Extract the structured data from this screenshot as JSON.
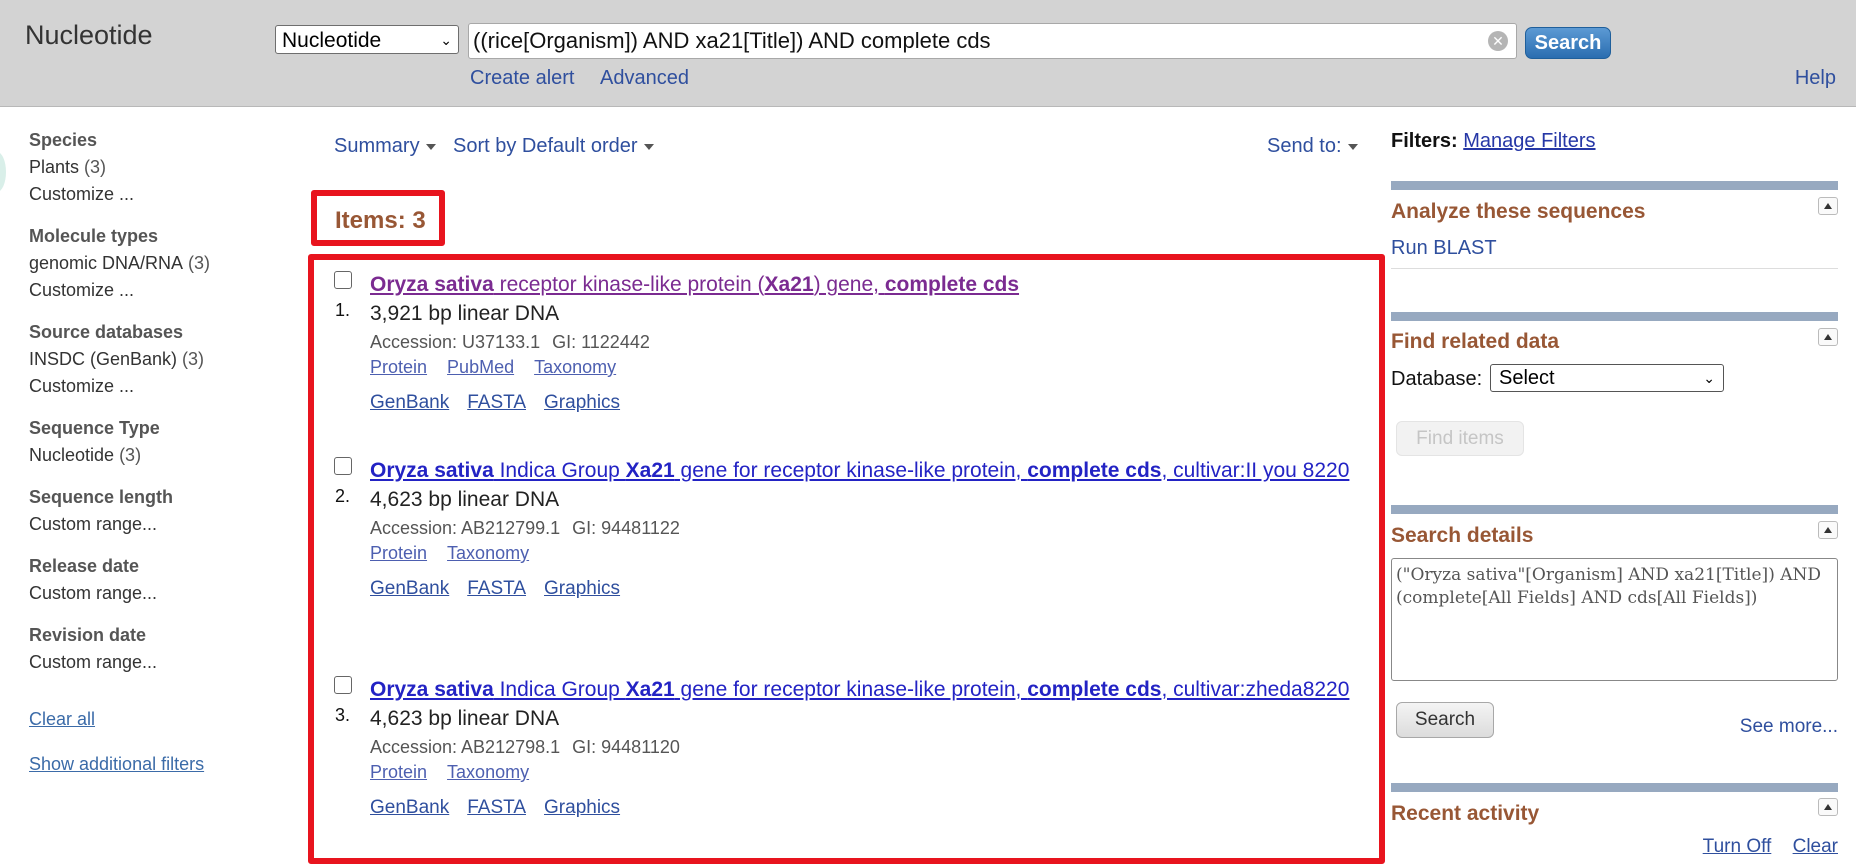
{
  "header": {
    "app_title": "Nucleotide",
    "db_select_value": "Nucleotide",
    "search_query": "((rice[Organism]) AND xa21[Title]) AND complete cds",
    "search_button": "Search",
    "create_alert": "Create alert",
    "advanced": "Advanced",
    "help": "Help"
  },
  "sidebar": {
    "facets": [
      {
        "heading": "Species",
        "items": [
          {
            "label": "Plants",
            "count": "(3)"
          },
          {
            "label": "Customize ...",
            "count": ""
          }
        ]
      },
      {
        "heading": "Molecule types",
        "items": [
          {
            "label": "genomic DNA/RNA",
            "count": "(3)"
          },
          {
            "label": "Customize ...",
            "count": ""
          }
        ]
      },
      {
        "heading": "Source databases",
        "items": [
          {
            "label": "INSDC (GenBank)",
            "count": "(3)"
          },
          {
            "label": "Customize ...",
            "count": ""
          }
        ]
      },
      {
        "heading": "Sequence Type",
        "items": [
          {
            "label": "Nucleotide",
            "count": "(3)"
          }
        ]
      },
      {
        "heading": "Sequence length",
        "items": [
          {
            "label": "Custom range...",
            "count": ""
          }
        ]
      },
      {
        "heading": "Release date",
        "items": [
          {
            "label": "Custom range...",
            "count": ""
          }
        ]
      },
      {
        "heading": "Revision date",
        "items": [
          {
            "label": "Custom range...",
            "count": ""
          }
        ]
      }
    ],
    "clear_all": "Clear all",
    "show_additional": "Show additional filters"
  },
  "toolbar": {
    "summary": "Summary",
    "sort": "Sort by Default order",
    "send_to": "Send to:"
  },
  "items_count": "Items: 3",
  "results": [
    {
      "number": "1.",
      "title_parts": [
        {
          "t": "Oryza sativa",
          "b": true
        },
        {
          "t": " receptor kinase-like protein (",
          "b": false
        },
        {
          "t": "Xa21",
          "b": true
        },
        {
          "t": ") gene, ",
          "b": false
        },
        {
          "t": "complete cds",
          "b": true
        }
      ],
      "visited": true,
      "meta": "3,921 bp linear DNA",
      "accession": "Accession: U37133.1",
      "gi": "GI: 1122442",
      "links": [
        "Protein",
        "PubMed",
        "Taxonomy"
      ],
      "links2": [
        "GenBank",
        "FASTA",
        "Graphics"
      ]
    },
    {
      "number": "2.",
      "title_parts": [
        {
          "t": "Oryza sativa",
          "b": true
        },
        {
          "t": " Indica Group ",
          "b": false
        },
        {
          "t": "Xa21",
          "b": true
        },
        {
          "t": " gene for receptor kinase-like protein, ",
          "b": false
        },
        {
          "t": "complete cds",
          "b": true
        },
        {
          "t": ", cultivar:II you 8220",
          "b": false
        }
      ],
      "visited": false,
      "meta": "4,623 bp linear DNA",
      "accession": "Accession: AB212799.1",
      "gi": "GI: 94481122",
      "links": [
        "Protein",
        "Taxonomy"
      ],
      "links2": [
        "GenBank",
        "FASTA",
        "Graphics"
      ]
    },
    {
      "number": "3.",
      "title_parts": [
        {
          "t": "Oryza sativa",
          "b": true
        },
        {
          "t": " Indica Group ",
          "b": false
        },
        {
          "t": "Xa21",
          "b": true
        },
        {
          "t": " gene for receptor kinase-like protein, ",
          "b": false
        },
        {
          "t": "complete cds",
          "b": true
        },
        {
          "t": ", cultivar:zheda8220",
          "b": false
        }
      ],
      "visited": false,
      "meta": "4,623 bp linear DNA",
      "accession": "Accession: AB212798.1",
      "gi": "GI: 94481120",
      "links": [
        "Protein",
        "Taxonomy"
      ],
      "links2": [
        "GenBank",
        "FASTA",
        "Graphics"
      ]
    }
  ],
  "right": {
    "filters_label": "Filters:",
    "manage_filters": "Manage Filters",
    "analyze_title": "Analyze these sequences",
    "run_blast": "Run BLAST",
    "related_title": "Find related data",
    "database_label": "Database:",
    "database_value": "Select",
    "find_items": "Find items",
    "details_title": "Search details",
    "details_text": "(\"Oryza sativa\"[Organism] AND xa21[Title]) AND (complete[All Fields] AND cds[All Fields])",
    "details_search": "Search",
    "see_more": "See more...",
    "recent_title": "Recent activity",
    "turn_off": "Turn Off",
    "clear": "Clear"
  },
  "colors": {
    "highlight_border": "#e8141e",
    "portlet_title": "#985735",
    "link": "#2323c4",
    "visited": "#7b2b91"
  }
}
